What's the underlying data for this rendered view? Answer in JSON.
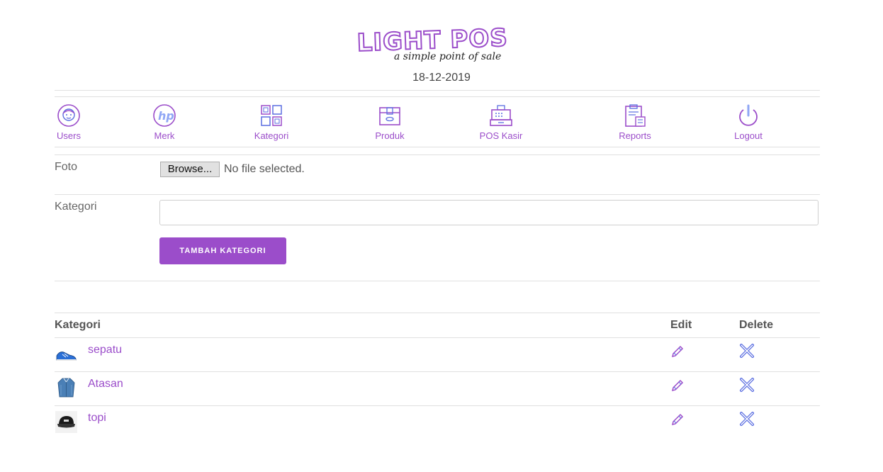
{
  "header": {
    "logo_title": "LIGHT POS",
    "logo_tagline": "a simple point of sale",
    "date": "18-12-2019"
  },
  "nav": [
    {
      "label": "Users",
      "icon": "user-face-icon"
    },
    {
      "label": "Merk",
      "icon": "hp-logo-icon"
    },
    {
      "label": "Kategori",
      "icon": "grid-icon"
    },
    {
      "label": "Produk",
      "icon": "box-icon"
    },
    {
      "label": "POS Kasir",
      "icon": "cash-register-icon"
    },
    {
      "label": "Reports",
      "icon": "clipboard-report-icon"
    },
    {
      "label": "Logout",
      "icon": "power-icon"
    }
  ],
  "form": {
    "foto_label": "Foto",
    "browse_label": "Browse...",
    "file_status": "No file selected.",
    "kategori_label": "Kategori",
    "kategori_value": "",
    "submit_label": "TAMBAH KATEGORI"
  },
  "table": {
    "headers": {
      "kategori": "Kategori",
      "edit": "Edit",
      "delete": "Delete"
    },
    "rows": [
      {
        "name": "sepatu",
        "thumb": "shoe"
      },
      {
        "name": "Atasan",
        "thumb": "shirt"
      },
      {
        "name": "topi",
        "thumb": "cap"
      }
    ]
  },
  "colors": {
    "accent": "#9b4dca",
    "accent_secondary": "#5b6ee1"
  }
}
